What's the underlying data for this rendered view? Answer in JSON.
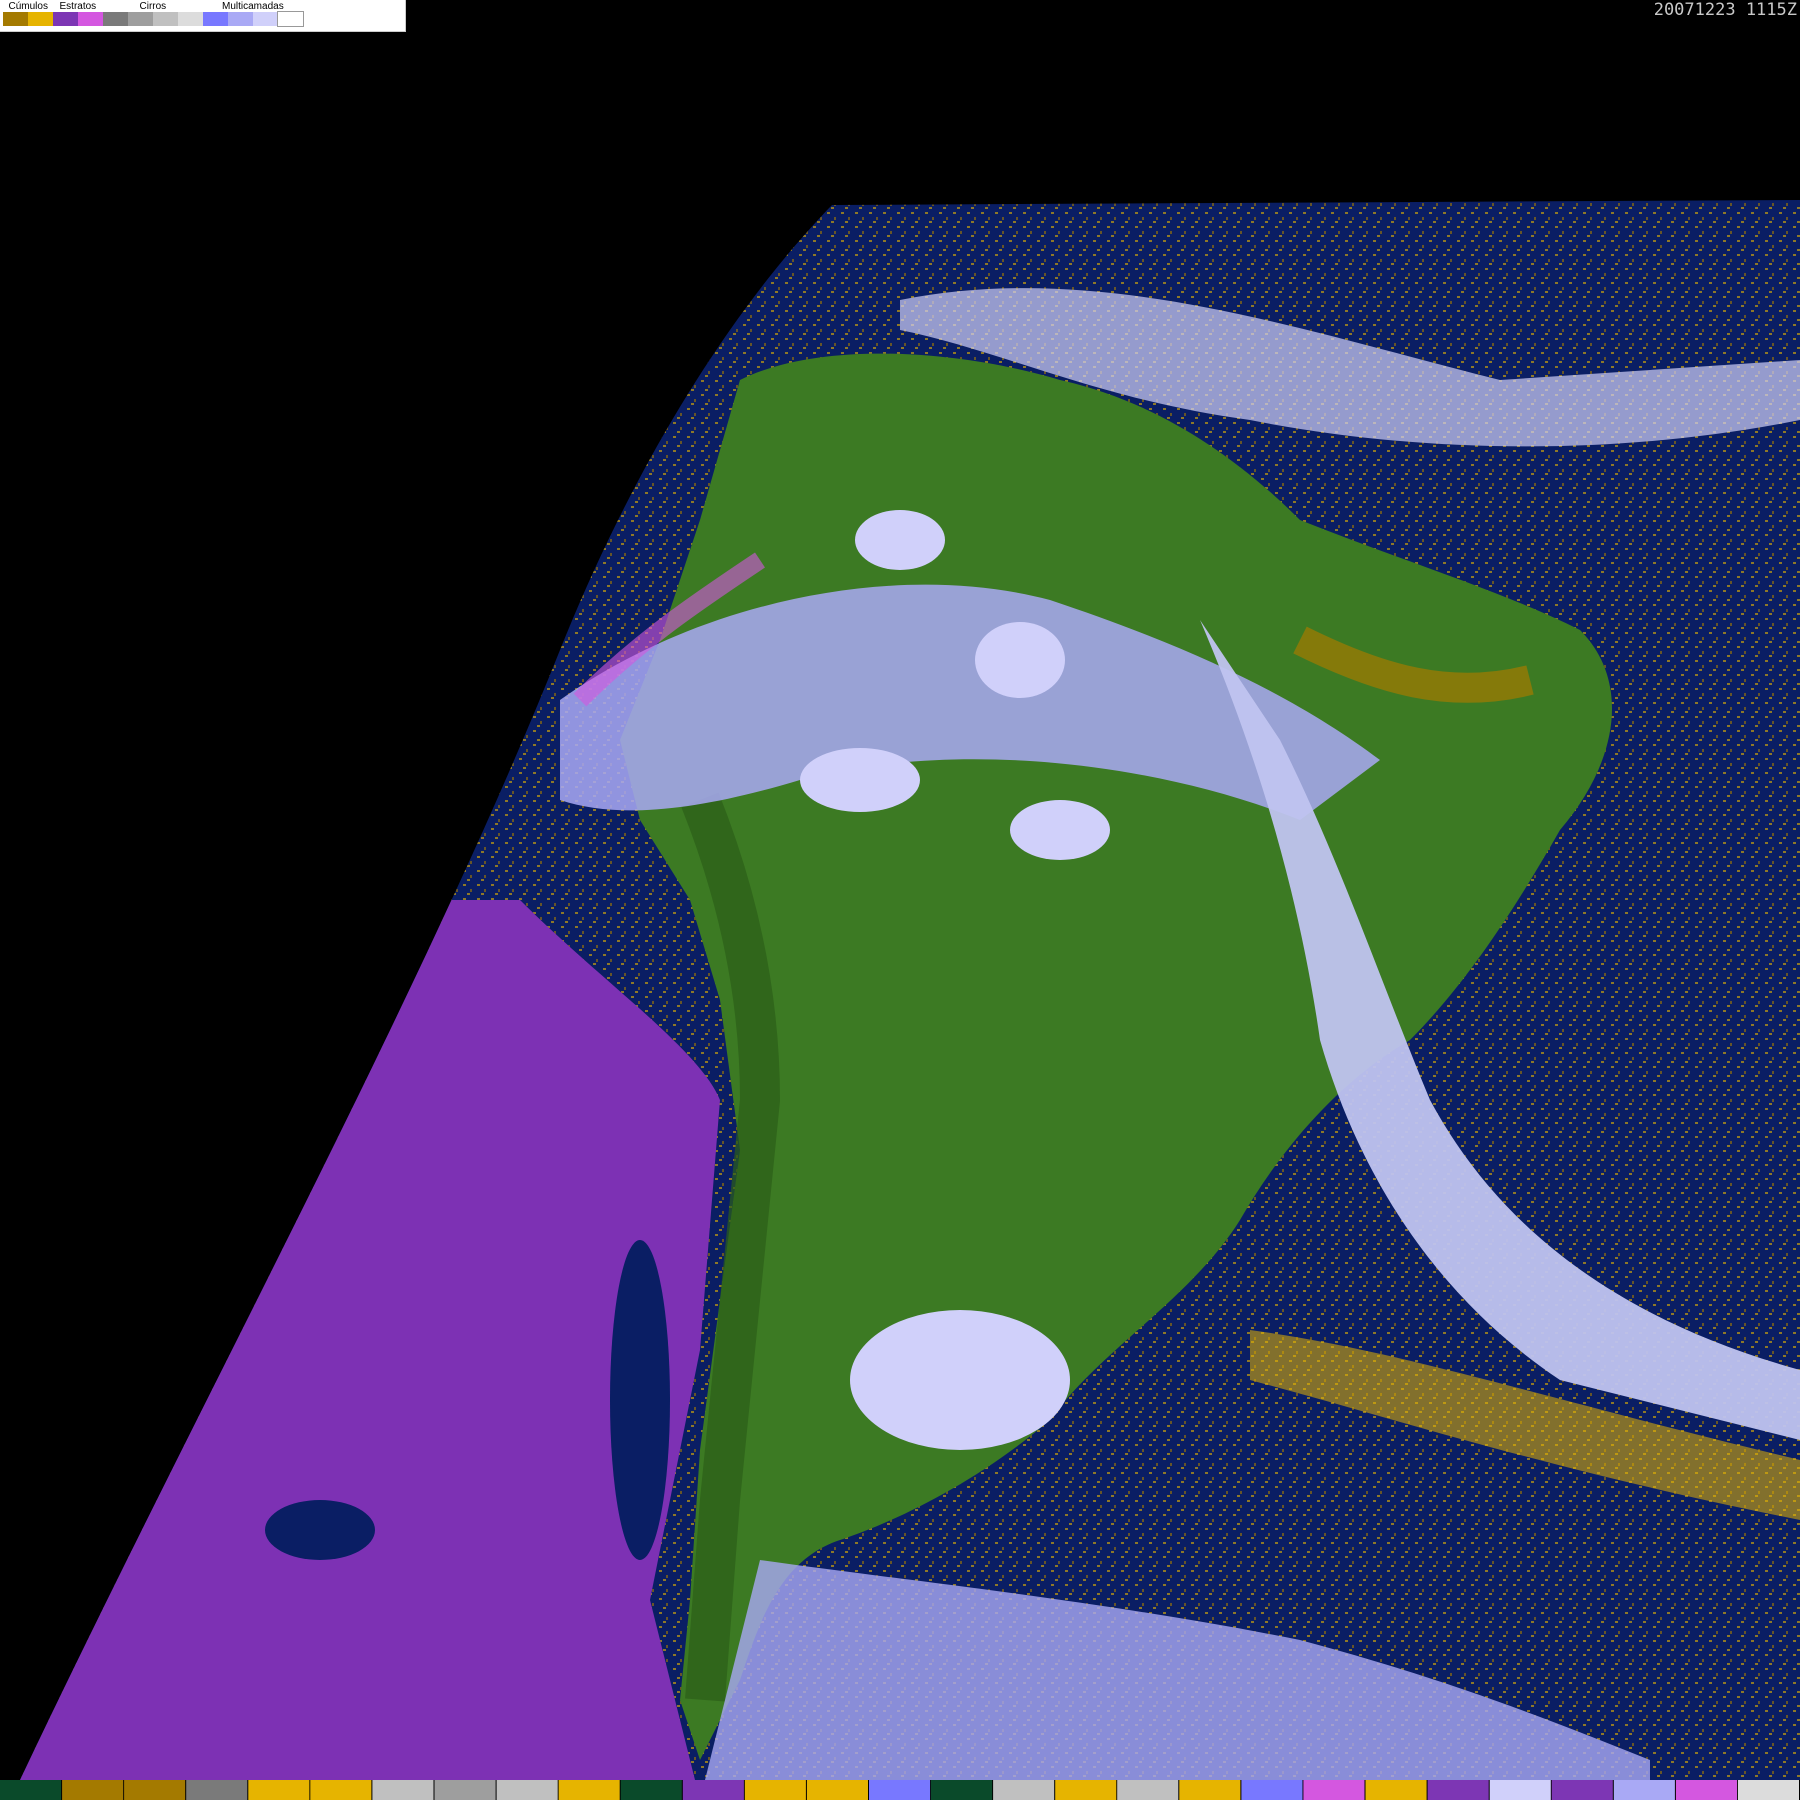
{
  "timestamp": "20071223  1115Z",
  "legend": {
    "groups": [
      {
        "label": "Cúmulos",
        "colors": [
          "#a47a00",
          "#e6b400"
        ]
      },
      {
        "label": "Estratos",
        "colors": [
          "#7d36b4",
          "#d457e0"
        ]
      },
      {
        "label": "Cirros",
        "colors": [
          "#7a7a7a",
          "#9e9e9e",
          "#c0c0c0",
          "#dcdcdc"
        ]
      },
      {
        "label": "Multicamadas",
        "colors": [
          "#7878ff",
          "#a9a9f5",
          "#d0d0fa",
          "#ffffff"
        ]
      }
    ]
  },
  "map_colors": {
    "space": "#000000",
    "ocean": "#0a1e64",
    "land": "#3c7a23",
    "land_dark": "#2b5e18",
    "stratus_sea": "#7d31b4",
    "cumulus_dark": "#a47a00",
    "cumulus_light": "#e6b400",
    "multilayer": "#7878ff",
    "multilayer_light": "#d0d0fa"
  },
  "bottom_strip": [
    "#0a4a2a",
    "#a47a00",
    "#a47a00",
    "#7a7a7a",
    "#e6b400",
    "#e6b400",
    "#c0c0c0",
    "#9e9e9e",
    "#c0c0c0",
    "#e6b400",
    "#0a4a2a",
    "#7d36b4",
    "#e6b400",
    "#e6b400",
    "#7878ff",
    "#0a4a2a",
    "#c0c0c0",
    "#e6b400",
    "#c0c0c0",
    "#e6b400",
    "#7878ff",
    "#d457e0",
    "#e6b400",
    "#7d36b4",
    "#d0d0fa",
    "#7d36b4",
    "#a9a9f5",
    "#d457e0",
    "#dcdcdc"
  ]
}
